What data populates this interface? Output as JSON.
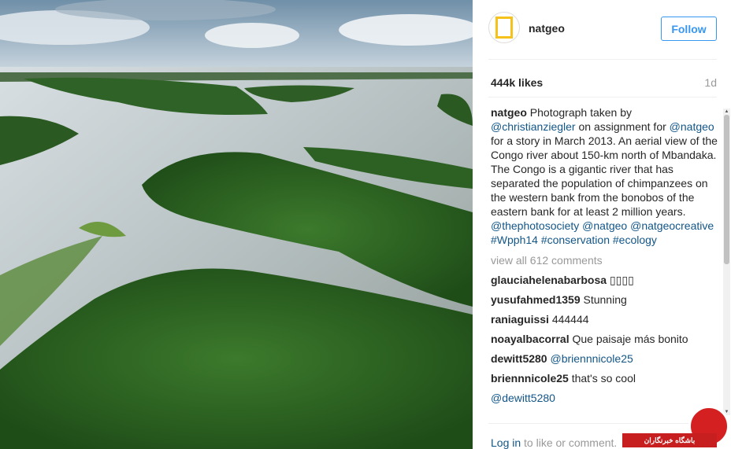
{
  "post": {
    "username": "natgeo",
    "avatar_text": "NATIONAL GEOGRAPHIC",
    "follow_label": "Follow",
    "likes": "444k likes",
    "age": "1d"
  },
  "caption": {
    "author": "natgeo",
    "t1": " Photograph taken by ",
    "m1": "@christianziegler",
    "t2": " on assignment for ",
    "m2": "@natgeo",
    "t3": " for a story in March 2013. An aerial view of the Congo river about 150-km north of Mbandaka. The Congo is a gigantic river that has separated the population of chimpanzees on the western bank from the bonobos of the eastern bank for at least 2 million years. ",
    "m3": "@thephotosociety",
    "m4": "@natgeo",
    "m5": "@natgeocreative",
    "h1": "#Wpph14",
    "h2": "#conservation",
    "h3": "#ecology"
  },
  "view_all": "view all 612 comments",
  "comments": [
    {
      "user": "glauciahelenabarbosa",
      "text": "▯▯▯▯"
    },
    {
      "user": "yusufahmed1359",
      "text": "Stunning"
    },
    {
      "user": "raniaguissi",
      "text": "444444"
    },
    {
      "user": "noayalbacorral",
      "text": "Que paisaje más bonito"
    },
    {
      "user": "dewitt5280",
      "text": "@briennnicole25"
    },
    {
      "user": "briennnicole25",
      "text": "that's so cool"
    },
    {
      "user": "",
      "text": "@dewitt5280"
    }
  ],
  "login": {
    "link": "Log in",
    "rest": " to like or comment."
  },
  "watermark": {
    "text": "باشگاه خبرنگاران"
  },
  "colors": {
    "accent": "#3897f0",
    "link": "#125688",
    "muted": "#999999",
    "watermark": "#c71f1f"
  }
}
